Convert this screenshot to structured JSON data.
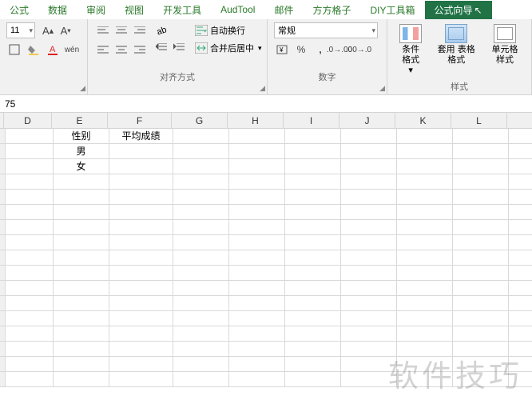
{
  "tabs": {
    "items": [
      "公式",
      "数据",
      "审阅",
      "视图",
      "开发工具",
      "AudTool",
      "邮件",
      "方方格子",
      "DIY工具箱",
      "公式向导"
    ],
    "activeIndex": 9
  },
  "font": {
    "size": "11",
    "grow": "A",
    "shrink": "A"
  },
  "align": {
    "wrap": "自动换行",
    "merge": "合并后居中",
    "label": "对齐方式"
  },
  "number": {
    "format": "常规",
    "label": "数字"
  },
  "styles": {
    "cond": "条件格式",
    "tablefmt": "套用\n表格格式",
    "cellstyle": "单元格样式",
    "label": "样式"
  },
  "formula_bar": "75",
  "columns": [
    "D",
    "E",
    "F",
    "G",
    "H",
    "I",
    "J",
    "K",
    "L"
  ],
  "cells": {
    "E1": "性别",
    "F1": "平均成绩",
    "E2": "男",
    "E3": "女"
  },
  "watermark": "软件技巧"
}
